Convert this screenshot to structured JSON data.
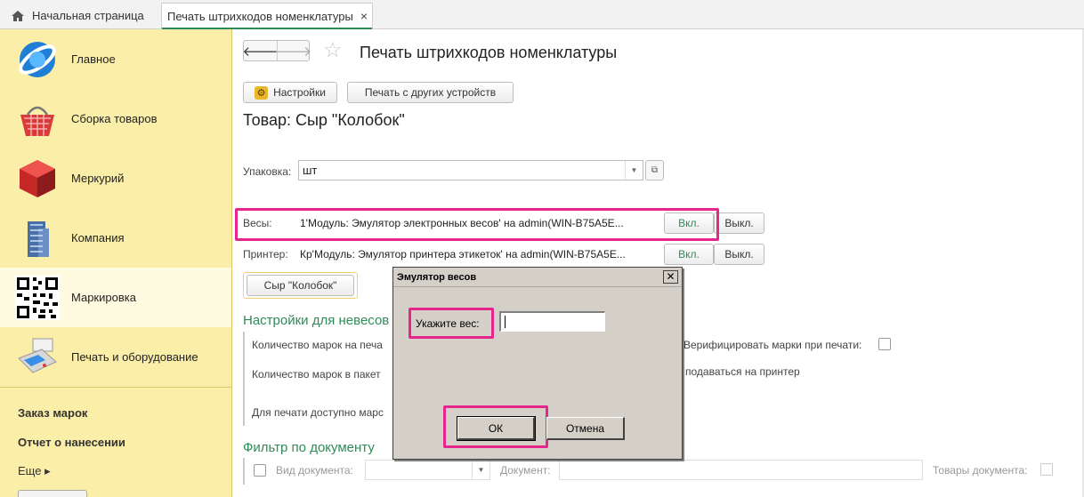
{
  "tabs": {
    "home": "Начальная страница",
    "active": "Печать штрихкодов номенклатуры",
    "close": "×"
  },
  "sidebar": {
    "items": [
      {
        "label": "Главное",
        "icon": "globe-logo-icon"
      },
      {
        "label": "Сборка товаров",
        "icon": "shopping-basket-icon"
      },
      {
        "label": "Меркурий",
        "icon": "red-cube-icon"
      },
      {
        "label": "Компания",
        "icon": "office-building-icon"
      },
      {
        "label": "Маркировка",
        "icon": "qr-code-icon"
      },
      {
        "label": "Печать и оборудование",
        "icon": "pos-terminal-icon"
      }
    ],
    "links": [
      "Заказ марок",
      "Отчет о нанесении"
    ],
    "more": "Еще ▸"
  },
  "toolbar": {
    "back": "🡐",
    "forward": "🡒",
    "star": "☆",
    "title": "Печать штрихкодов номенклатуры",
    "settings": "Настройки",
    "other_devices": "Печать с других устройств"
  },
  "product": {
    "title": "Товар: Сыр \"Колобок\""
  },
  "package": {
    "label": "Упаковка:",
    "value": "шт",
    "arrow": "▼",
    "open": "⧉"
  },
  "devices": {
    "scales_label": "Весы:",
    "scales_value": "1'Модуль: Эмулятор электронных весов' на admin(WIN-B75A5E...",
    "printer_label": "Принтер:",
    "printer_value": "Кр'Модуль: Эмулятор принтера этикеток' на admin(WIN-B75A5E...",
    "on": "Вкл.",
    "off": "Выкл."
  },
  "print_button": "Сыр \"Колобок\"",
  "settings_group": {
    "title": "Настройки для невесов",
    "field1": "Количество марок на печа",
    "field2": "Количество марок в пакет",
    "field3": "Для печати доступно марс",
    "verify": "Верифицировать марки при печати:",
    "printer_text": "подаваться на принтер"
  },
  "filter_group": {
    "title": "Фильтр по документу",
    "doc_type": "Вид документа:",
    "document": "Документ:",
    "goods": "Товары документа:"
  },
  "dialog": {
    "title": "Эмулятор весов",
    "close": "✕",
    "label": "Укажите вес:",
    "value": "",
    "ok": "ОК",
    "cancel": "Отмена"
  },
  "colors": {
    "sidebar": "#fbeea8",
    "accent_green": "#2e8b57",
    "highlight": "#e6268d",
    "dialog_bg": "#d4d0c8"
  }
}
